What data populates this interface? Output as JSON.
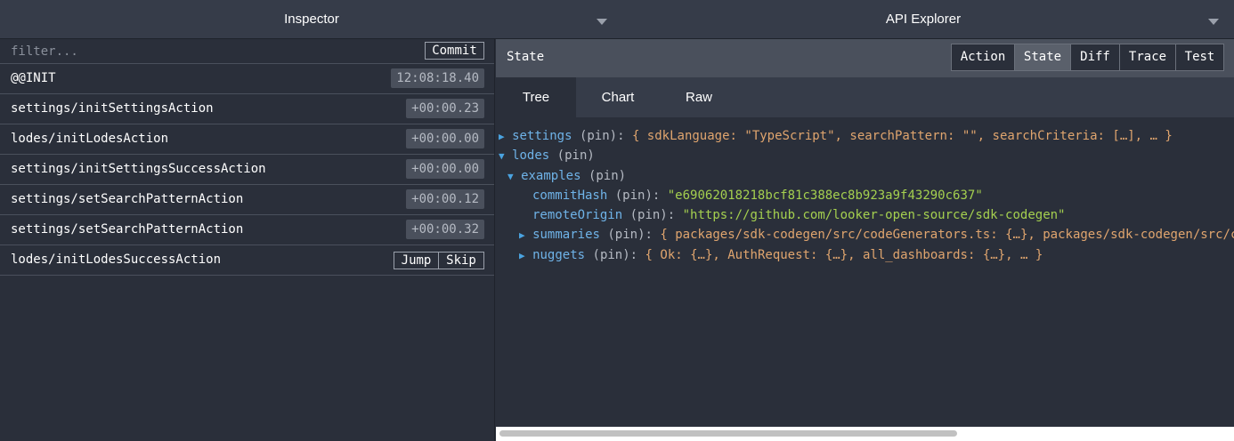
{
  "header": {
    "left_tab": "Inspector",
    "right_tab": "API Explorer"
  },
  "inspector": {
    "filter_placeholder": "filter...",
    "commit_label": "Commit",
    "actions": [
      {
        "name": "@@INIT",
        "time": "12:08:18.40"
      },
      {
        "name": "settings/initSettingsAction",
        "time": "+00:00.23"
      },
      {
        "name": "lodes/initLodesAction",
        "time": "+00:00.00"
      },
      {
        "name": "settings/initSettingsSuccessAction",
        "time": "+00:00.00"
      },
      {
        "name": "settings/setSearchPatternAction",
        "time": "+00:00.12"
      },
      {
        "name": "settings/setSearchPatternAction",
        "time": "+00:00.32"
      },
      {
        "name": "lodes/initLodesSuccessAction",
        "jump_label": "Jump",
        "skip_label": "Skip"
      }
    ]
  },
  "monitor": {
    "title": "State",
    "modes": [
      "Action",
      "State",
      "Diff",
      "Trace",
      "Test"
    ],
    "active_mode": "State",
    "subtabs": [
      "Tree",
      "Chart",
      "Raw"
    ],
    "active_subtab": "Tree",
    "tree": {
      "settings": {
        "key": "settings",
        "pin": "(pin):",
        "summary": "{ sdkLanguage: \"TypeScript\", searchPattern: \"\", searchCriteria: […], … }"
      },
      "lodes": {
        "key": "lodes",
        "pin": "(pin)"
      },
      "examples": {
        "key": "examples",
        "pin": "(pin)"
      },
      "commitHash": {
        "key": "commitHash",
        "pin": "(pin):",
        "value": "\"e69062018218bcf81c388ec8b923a9f43290c637\""
      },
      "remoteOrigin": {
        "key": "remoteOrigin",
        "pin": "(pin):",
        "value": "\"https://github.com/looker-open-source/sdk-codegen\""
      },
      "summaries": {
        "key": "summaries",
        "pin": "(pin):",
        "summary": "{ packages/sdk-codegen/src/codeGenerators.ts: {…}, packages/sdk-codegen/src/codeGen"
      },
      "nuggets": {
        "key": "nuggets",
        "pin": "(pin):",
        "summary": "{ Ok: {…}, AuthRequest: {…}, all_dashboards: {…}, … }"
      }
    }
  }
}
